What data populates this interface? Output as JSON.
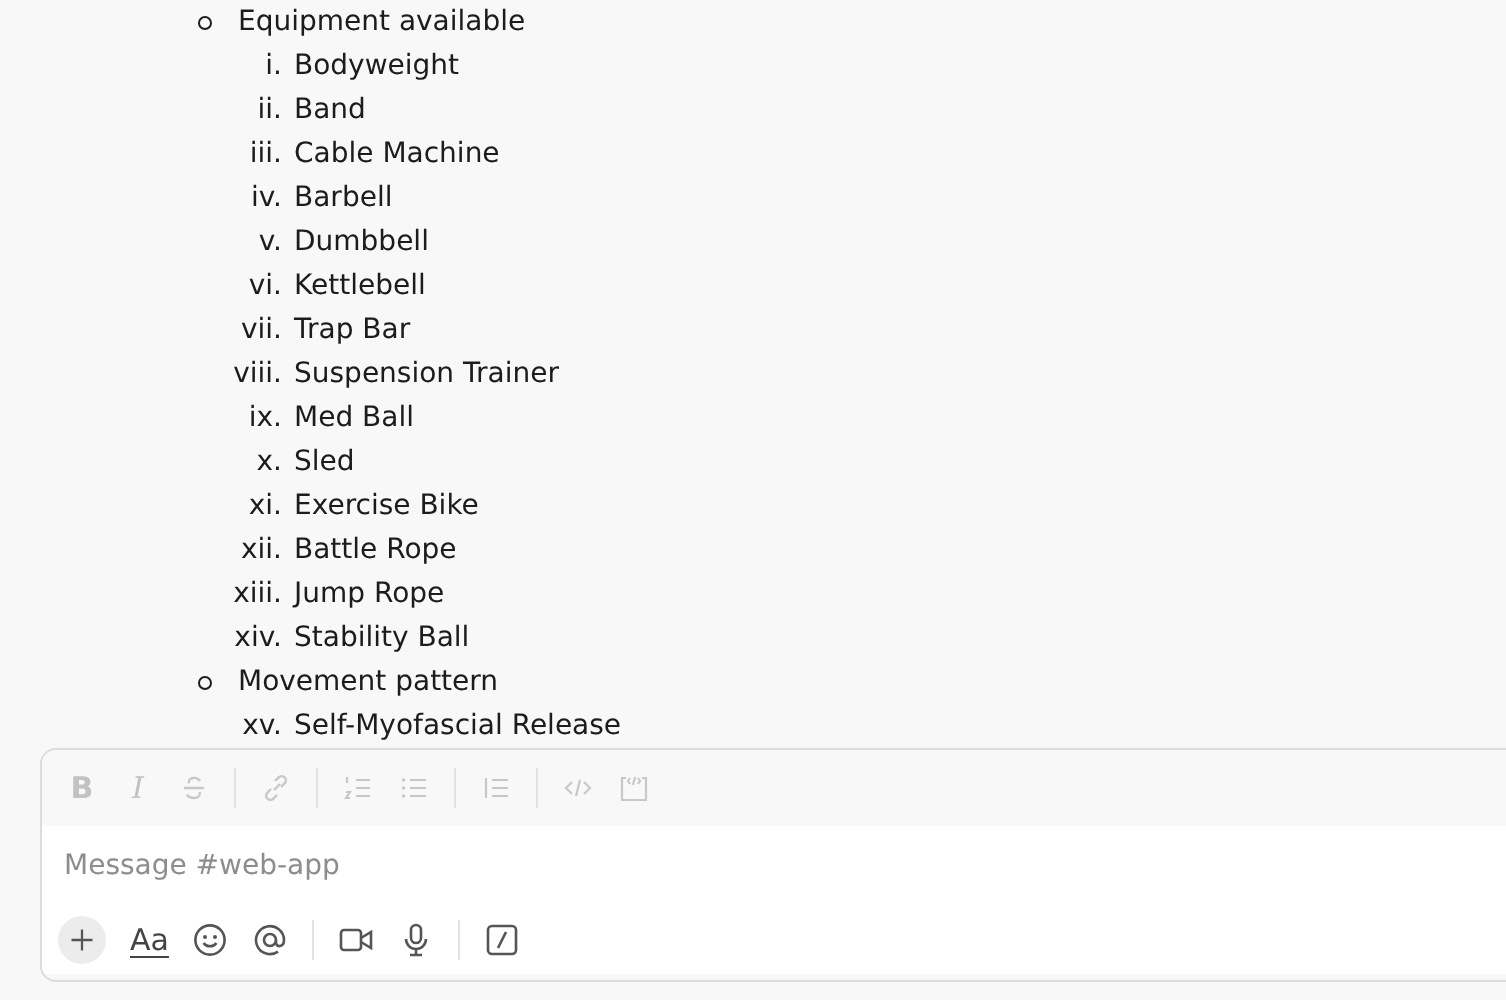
{
  "outline": [
    {
      "label": "Equipment available",
      "items": [
        {
          "number": "i.",
          "text": "Bodyweight"
        },
        {
          "number": "ii.",
          "text": "Band"
        },
        {
          "number": "iii.",
          "text": "Cable Machine"
        },
        {
          "number": "iv.",
          "text": "Barbell"
        },
        {
          "number": "v.",
          "text": "Dumbbell"
        },
        {
          "number": "vi.",
          "text": "Kettlebell"
        },
        {
          "number": "vii.",
          "text": "Trap Bar"
        },
        {
          "number": "viii.",
          "text": "Suspension Trainer"
        },
        {
          "number": "ix.",
          "text": "Med Ball"
        },
        {
          "number": "x.",
          "text": "Sled"
        },
        {
          "number": "xi.",
          "text": "Exercise Bike"
        },
        {
          "number": "xii.",
          "text": "Battle Rope"
        },
        {
          "number": "xiii.",
          "text": "Jump Rope"
        },
        {
          "number": "xiv.",
          "text": "Stability Ball"
        }
      ]
    },
    {
      "label": "Movement pattern",
      "items": [
        {
          "number": "xv.",
          "text": "Self-Myofascial Release"
        }
      ]
    }
  ],
  "composer": {
    "format_toolbar": [
      {
        "kind": "bold",
        "text": "B"
      },
      {
        "kind": "italic",
        "text": "I"
      },
      {
        "kind": "strike"
      },
      {
        "kind": "divider"
      },
      {
        "kind": "link"
      },
      {
        "kind": "divider"
      },
      {
        "kind": "ordered"
      },
      {
        "kind": "bulleted"
      },
      {
        "kind": "divider"
      },
      {
        "kind": "quote"
      },
      {
        "kind": "divider"
      },
      {
        "kind": "code"
      },
      {
        "kind": "codeblock"
      }
    ],
    "placeholder": "Message #web-app",
    "actions": [
      {
        "kind": "plus"
      },
      {
        "kind": "format",
        "text": "Aa"
      },
      {
        "kind": "emoji"
      },
      {
        "kind": "mention"
      },
      {
        "kind": "divider"
      },
      {
        "kind": "video"
      },
      {
        "kind": "mic"
      },
      {
        "kind": "divider"
      },
      {
        "kind": "shortcut"
      }
    ]
  }
}
